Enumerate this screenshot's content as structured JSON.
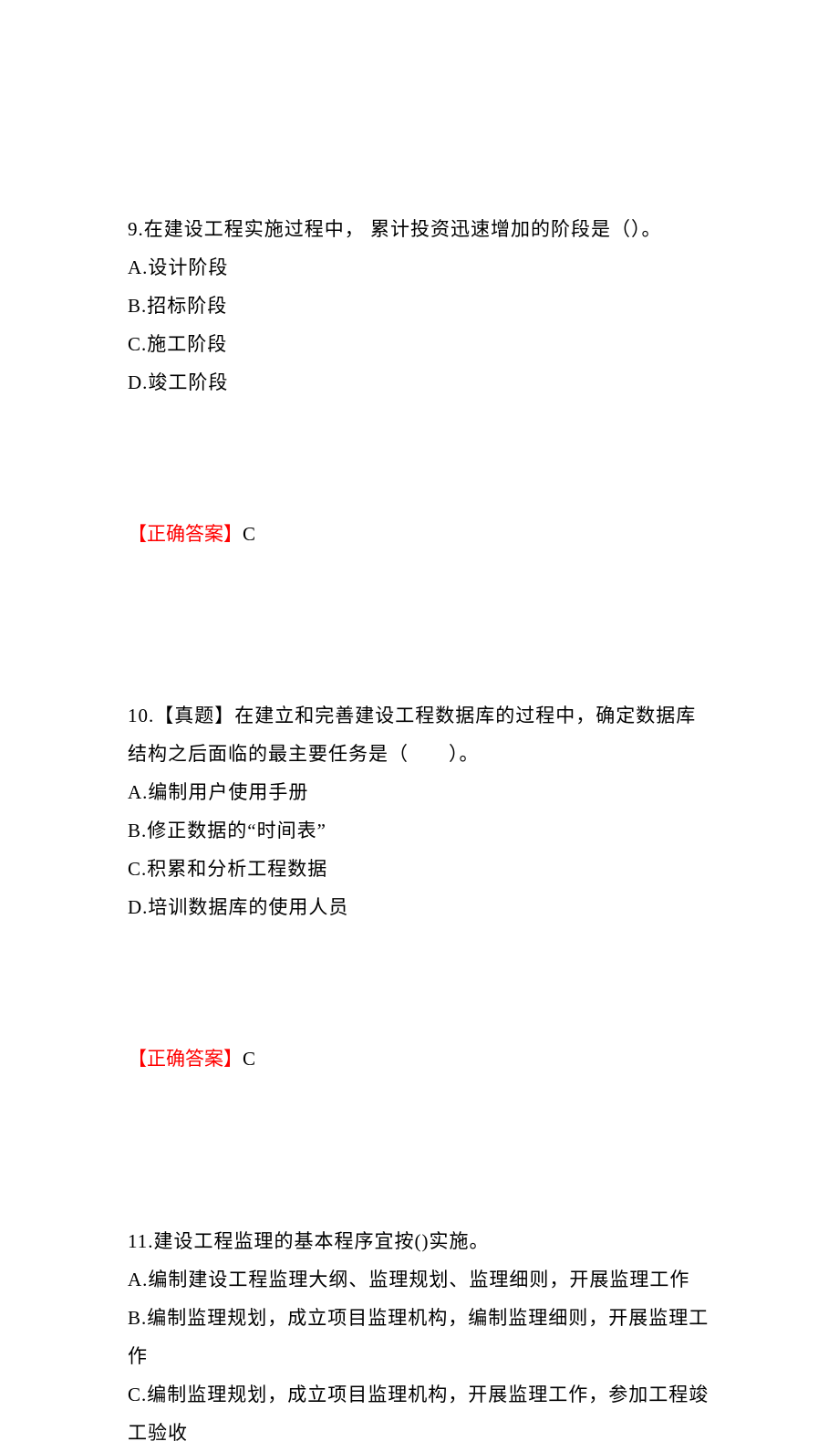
{
  "questions": [
    {
      "number": "9.",
      "stem": "在建设工程实施过程中， 累计投资迅速增加的阶段是（）。",
      "options": [
        "A.设计阶段",
        "B.招标阶段",
        "C.施工阶段",
        "D.竣工阶段"
      ],
      "answer_label": "【正确答案】",
      "answer_value": "C"
    },
    {
      "number": "10.",
      "stem": "【真题】在建立和完善建设工程数据库的过程中，确定数据库结构之后面临的最主要任务是（　　）。",
      "options": [
        "A.编制用户使用手册",
        "B.修正数据的“时间表”",
        "C.积累和分析工程数据",
        "D.培训数据库的使用人员"
      ],
      "answer_label": "【正确答案】",
      "answer_value": "C"
    },
    {
      "number": "11.",
      "stem": "建设工程监理的基本程序宜按()实施。",
      "options": [
        "A.编制建设工程监理大纲、监理规划、监理细则，开展监理工作",
        "B.编制监理规划，成立项目监理机构，编制监理细则，开展监理工作",
        "C.编制监理规划，成立项目监理机构，开展监理工作，参加工程竣工验收"
      ],
      "answer_label": "",
      "answer_value": ""
    }
  ]
}
